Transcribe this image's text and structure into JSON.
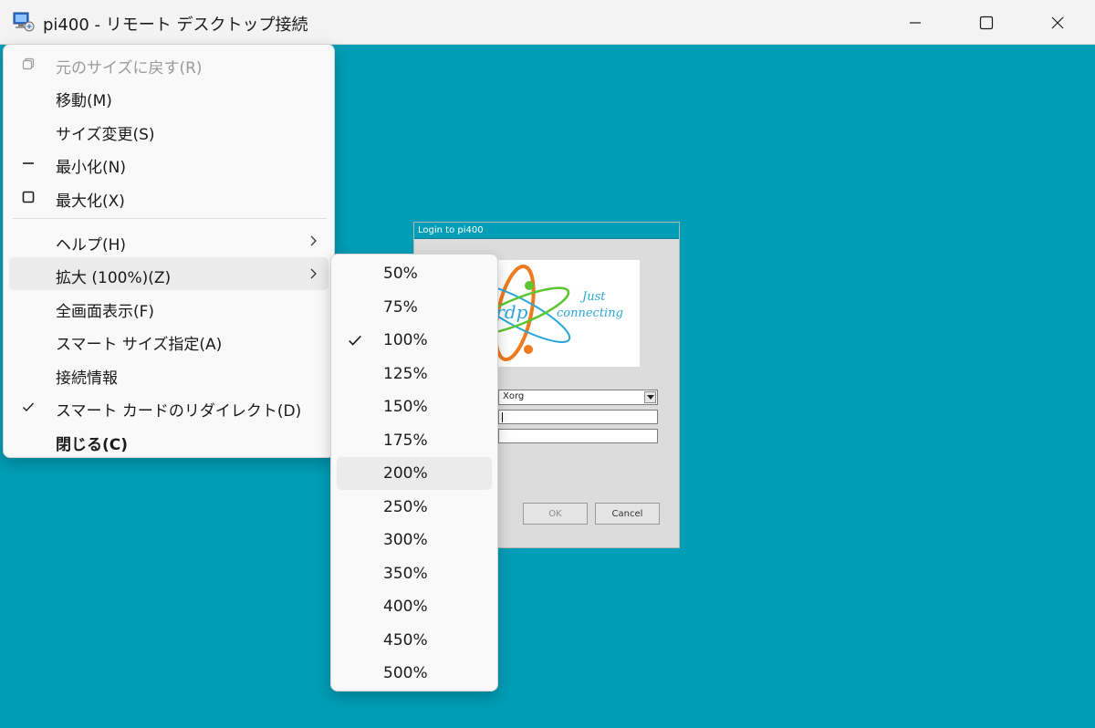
{
  "window": {
    "title": "pi400 - リモート デスクトップ接続"
  },
  "system_menu": {
    "items": [
      {
        "label": "元のサイズに戻す(R)",
        "icon": "restore-icon",
        "enabled": false
      },
      {
        "label": "移動(M)",
        "enabled": true
      },
      {
        "label": "サイズ変更(S)",
        "enabled": true
      },
      {
        "label": "最小化(N)",
        "icon": "minimize-icon",
        "enabled": true
      },
      {
        "label": "最大化(X)",
        "icon": "maximize-icon",
        "enabled": true
      },
      {
        "label": "ヘルプ(H)",
        "has_submenu": true
      },
      {
        "label": "拡大 (100%)(Z)",
        "has_submenu": true,
        "highlighted": true
      },
      {
        "label": "全画面表示(F)"
      },
      {
        "label": "スマート サイズ指定(A)"
      },
      {
        "label": "接続情報"
      },
      {
        "label": "スマート カードのリダイレクト(D)",
        "checked": true
      },
      {
        "label": "閉じる(C)",
        "bold": true
      }
    ]
  },
  "zoom_menu": {
    "items": [
      {
        "label": "50%"
      },
      {
        "label": "75%"
      },
      {
        "label": "100%",
        "checked": true
      },
      {
        "label": "125%"
      },
      {
        "label": "150%"
      },
      {
        "label": "175%"
      },
      {
        "label": "200%",
        "highlighted": true
      },
      {
        "label": "250%"
      },
      {
        "label": "300%"
      },
      {
        "label": "350%"
      },
      {
        "label": "400%"
      },
      {
        "label": "450%"
      },
      {
        "label": "500%"
      }
    ]
  },
  "xrdp_login": {
    "title": "Login to pi400",
    "logo_text": "xrdp",
    "tagline_1": "Just",
    "tagline_2": "connecting",
    "session_value": "Xorg",
    "ok_label": "OK",
    "cancel_label": "Cancel"
  },
  "colors": {
    "desktop_bg": "#009db6",
    "menu_bg": "#f9f9f9",
    "menu_hover": "#ebebeb",
    "logo_orange": "#f07a1e",
    "logo_green": "#5ec531",
    "logo_blue": "#2aa7d9"
  }
}
